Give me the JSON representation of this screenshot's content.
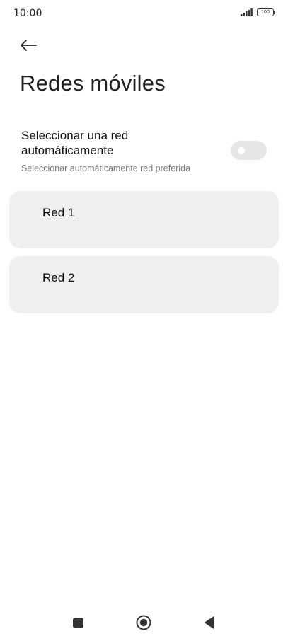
{
  "status_bar": {
    "time": "10:00",
    "battery_level": "100",
    "icons": [
      "signal-icon",
      "battery-icon"
    ]
  },
  "header": {
    "back_icon": "arrow-left-icon",
    "title": "Redes móviles"
  },
  "auto_select": {
    "title": "Seleccionar una red automáticamente",
    "subtitle": "Seleccionar automáticamente red preferida",
    "enabled": false
  },
  "networks": [
    {
      "label": "Red 1"
    },
    {
      "label": "Red 2"
    }
  ],
  "nav_bar": {
    "icons": [
      "recents-square-icon",
      "home-circle-icon",
      "back-triangle-icon"
    ]
  },
  "colors": {
    "background": "#ffffff",
    "card": "#efefef",
    "toggle_off": "#e6e6e6",
    "text_primary": "#111111",
    "text_secondary": "#777777"
  }
}
